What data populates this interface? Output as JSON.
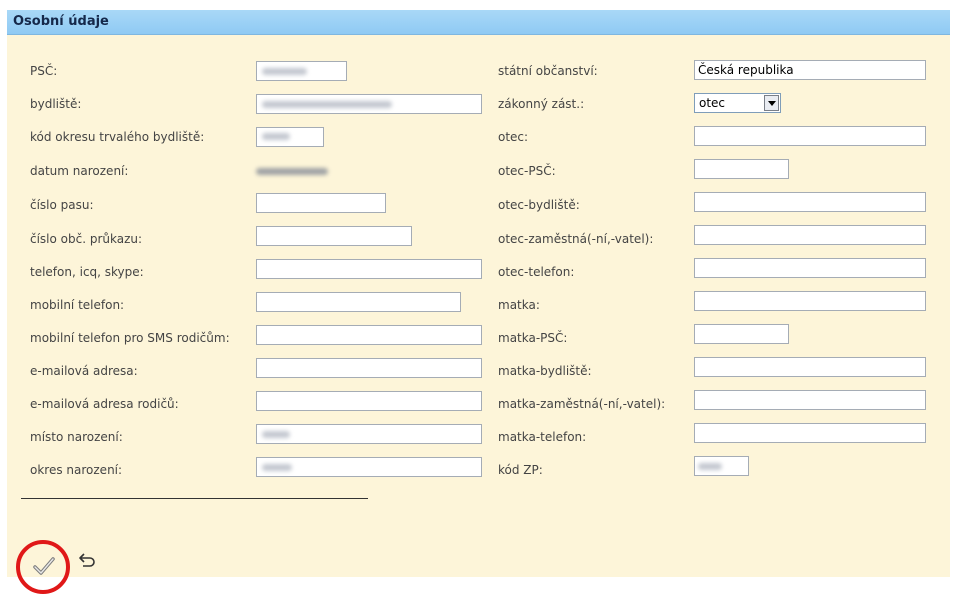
{
  "header": {
    "title": "Osobní údaje"
  },
  "left_fields": [
    {
      "label": "PSČ:",
      "value": "",
      "blurred": true
    },
    {
      "label": "bydliště:",
      "value": "",
      "blurred": true
    },
    {
      "label": "kód okresu trvalého bydliště:",
      "value": "",
      "blurred": true
    },
    {
      "label": "datum narození:",
      "value": "",
      "blurred": true,
      "readonly": true
    },
    {
      "label": "číslo pasu:",
      "value": ""
    },
    {
      "label": "číslo obč. průkazu:",
      "value": ""
    },
    {
      "label": "telefon, icq, skype:",
      "value": ""
    },
    {
      "label": "mobilní telefon:",
      "value": ""
    },
    {
      "label": "mobilní telefon pro SMS rodičům:",
      "value": ""
    },
    {
      "label": "e-mailová adresa:",
      "value": ""
    },
    {
      "label": "e-mailová adresa rodičů:",
      "value": ""
    },
    {
      "label": "místo narození:",
      "value": "",
      "blurred": true
    },
    {
      "label": "okres narození:",
      "value": "",
      "blurred": true
    }
  ],
  "right_fields": [
    {
      "label": "státní občanství:",
      "value": "Česká republika"
    },
    {
      "label": "zákonný zást.:",
      "value": "otec",
      "type": "select"
    },
    {
      "label": "otec:",
      "value": ""
    },
    {
      "label": "otec-PSČ:",
      "value": ""
    },
    {
      "label": "otec-bydliště:",
      "value": ""
    },
    {
      "label": "otec-zaměstná(-ní,-vatel):",
      "value": ""
    },
    {
      "label": "otec-telefon:",
      "value": ""
    },
    {
      "label": "matka:",
      "value": ""
    },
    {
      "label": "matka-PSČ:",
      "value": ""
    },
    {
      "label": "matka-bydliště:",
      "value": ""
    },
    {
      "label": "matka-zaměstná(-ní,-vatel):",
      "value": ""
    },
    {
      "label": "matka-telefon:",
      "value": ""
    },
    {
      "label": "kód ZP:",
      "value": "",
      "blurred": true
    }
  ],
  "actions": {
    "save_icon": "checkmark-icon",
    "back_icon": "undo-arrow-icon"
  },
  "colors": {
    "panel_background": "#fdf5d9",
    "header_background": "#99cff5",
    "highlight_circle": "#e01818"
  }
}
